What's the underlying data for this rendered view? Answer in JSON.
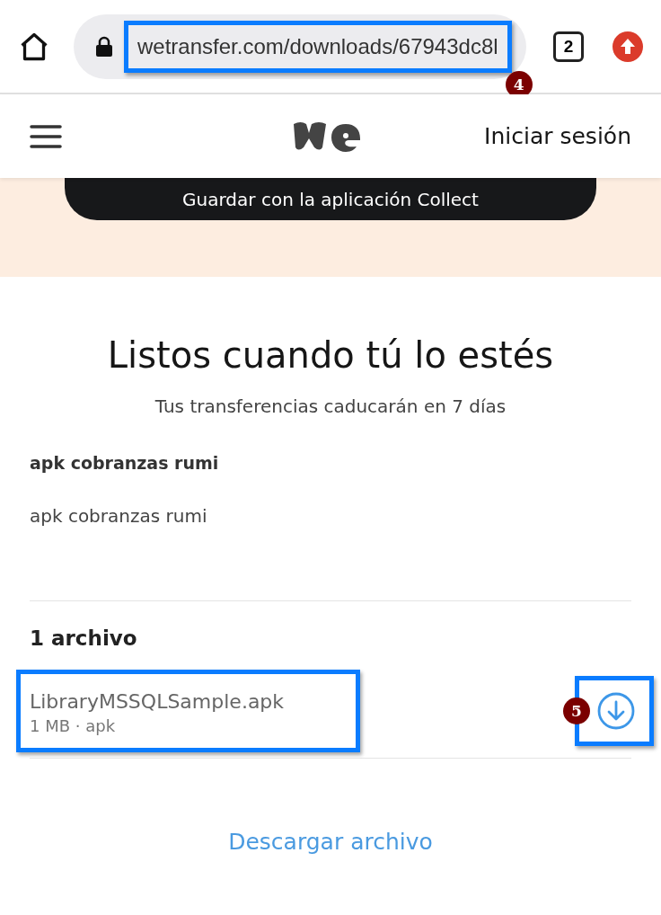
{
  "browser_bar": {
    "url": "wetransfer.com/downloads/67943dc8l",
    "url_highlighted": true,
    "url_callout": "4",
    "tab_count": "2"
  },
  "header": {
    "sign_in": "Iniciar sesión"
  },
  "banner": {
    "button": "Guardar con la aplicación Collect"
  },
  "transfer": {
    "title": "Listos cuando tú lo estés",
    "subtitle": "Tus transferencias caducarán en 7 días",
    "name": "apk cobranzas rumi",
    "message": "apk cobranzas rumi"
  },
  "files": {
    "count": "1 archivo",
    "items": [
      {
        "name": "LibraryMSSQLSample.apk",
        "meta": "1 MB · apk",
        "highlighted": true,
        "download_highlighted": true,
        "callout": "5"
      }
    ]
  },
  "download_all": "Descargar archivo"
}
